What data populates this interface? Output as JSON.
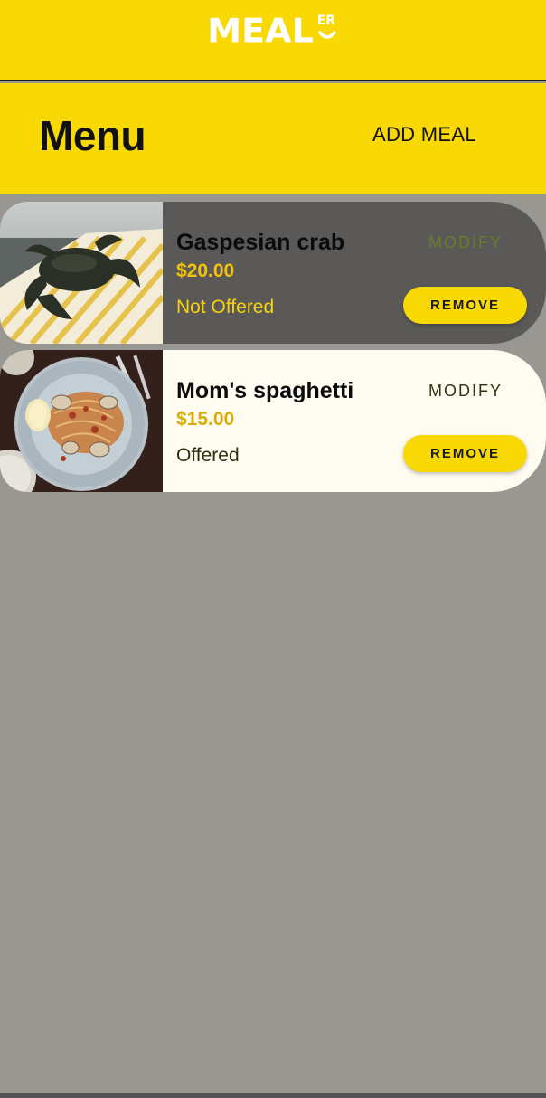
{
  "app": {
    "logo_text": "MEAL",
    "logo_suffix": "ER"
  },
  "header": {
    "title": "Menu",
    "add_meal_label": "ADD MEAL"
  },
  "meals": [
    {
      "name": "Gaspesian crab",
      "price": "$20.00",
      "status": "Not Offered",
      "modify_label": "MODIFY",
      "remove_label": "REMOVE",
      "image": "crab-photo"
    },
    {
      "name": "Mom's spaghetti",
      "price": "$15.00",
      "status": "Offered",
      "modify_label": "MODIFY",
      "remove_label": "REMOVE",
      "image": "spaghetti-photo"
    }
  ],
  "colors": {
    "brand_yellow": "#f8d805",
    "background_gray": "#989792",
    "disabled_card": "#5a5957",
    "active_card": "#fefbf1"
  }
}
